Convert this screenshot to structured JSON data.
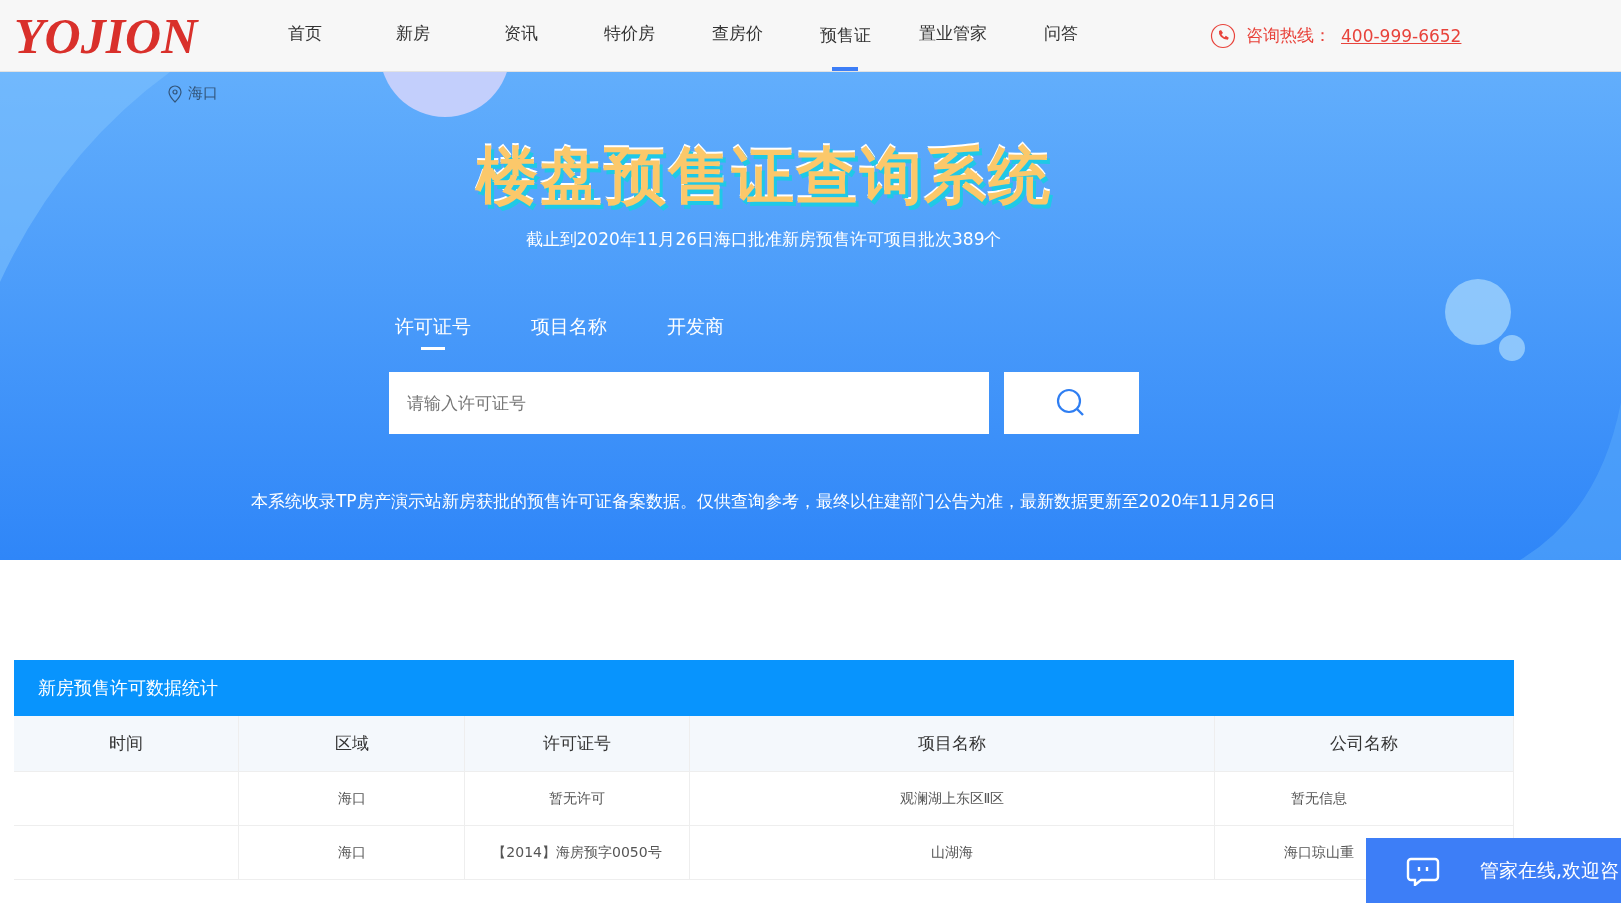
{
  "header": {
    "logo": "YOJION",
    "nav": [
      {
        "label": "首页",
        "selected": false
      },
      {
        "label": "新房",
        "selected": false
      },
      {
        "label": "资讯",
        "selected": false
      },
      {
        "label": "特价房",
        "selected": false
      },
      {
        "label": "查房价",
        "selected": false
      },
      {
        "label": "预售证",
        "selected": true
      },
      {
        "label": "置业管家",
        "selected": false
      },
      {
        "label": "问答",
        "selected": false
      }
    ],
    "hotline_label": "咨询热线：",
    "hotline_number": "400-999-6652"
  },
  "banner": {
    "city": "海口",
    "title": "楼盘预售证查询系统",
    "subtitle": "截止到2020年11月26日海口批准新房预售许可项目批次389个",
    "tabs": [
      {
        "label": "许可证号",
        "selected": true
      },
      {
        "label": "项目名称",
        "selected": false
      },
      {
        "label": "开发商",
        "selected": false
      }
    ],
    "search": {
      "placeholder": "请输入许可证号"
    },
    "note": "本系统收录TP房产演示站新房获批的预售许可证备案数据。仅供查询参考，最终以住建部门公告为准，最新数据更新至2020年11月26日"
  },
  "table": {
    "title": "新房预售许可数据统计",
    "columns": [
      "时间",
      "区域",
      "许可证号",
      "项目名称",
      "公司名称"
    ],
    "rows": [
      [
        "",
        "海口",
        "暂无许可",
        "观澜湖上东区Ⅱ区",
        "暂无信息"
      ],
      [
        "",
        "海口",
        "【2014】海房预字0050号",
        "山湖海",
        "海口琼山重"
      ]
    ]
  },
  "chat_widget": {
    "text": "管家在线,欢迎咨"
  }
}
